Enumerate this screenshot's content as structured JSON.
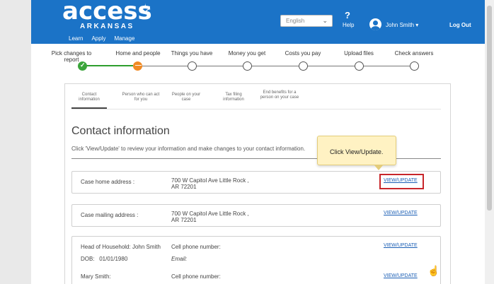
{
  "header": {
    "logo_text": "access",
    "logo_sub": "ARKANSAS",
    "nav": [
      "Learn",
      "Apply",
      "Manage"
    ],
    "language": "English",
    "help_symbol": "?",
    "help_label": "Help",
    "user_name": "John Smith ▾",
    "logout": "Log Out"
  },
  "progress": {
    "steps": [
      {
        "label": "Pick changes to report",
        "state": "done"
      },
      {
        "label": "Home and people",
        "state": "current"
      },
      {
        "label": "Things you have",
        "state": "todo"
      },
      {
        "label": "Money you get",
        "state": "todo"
      },
      {
        "label": "Costs you pay",
        "state": "todo"
      },
      {
        "label": "Upload files",
        "state": "todo"
      },
      {
        "label": "Check answers",
        "state": "todo"
      }
    ],
    "colors": {
      "done": "#3aa53a",
      "current": "#f08a24"
    }
  },
  "tabs": [
    {
      "label": "Contact information"
    },
    {
      "label": "Person who can act for you"
    },
    {
      "label": "People on your case"
    },
    {
      "label": "Tax filing information"
    },
    {
      "label": "End benefits for a person on your case"
    }
  ],
  "section": {
    "title": "Contact information",
    "instructions": "Click 'View/Update' to review your information and make changes to your contact information.",
    "tooltip": "Click View/Update."
  },
  "rows": {
    "home": {
      "label": "Case home address :",
      "value": "700 W Capitol Ave Little Rock ,\nAR 72201",
      "link": "VIEW/UPDATE"
    },
    "mailing": {
      "label": "Case mailing address :",
      "value": "700 W Capitol Ave Little Rock ,\nAR 72201",
      "link": "VIEW/UPDATE"
    },
    "household": {
      "head": "Head of Household: John Smith",
      "dob": "DOB:   01/01/1980",
      "cell": "Cell phone number:",
      "email": "Email:",
      "link": "VIEW/UPDATE"
    },
    "mary": {
      "name": "Mary Smith:",
      "cell": "Cell phone number:",
      "link": "VIEW/UPDATE"
    }
  },
  "accent": "#1b73c7"
}
